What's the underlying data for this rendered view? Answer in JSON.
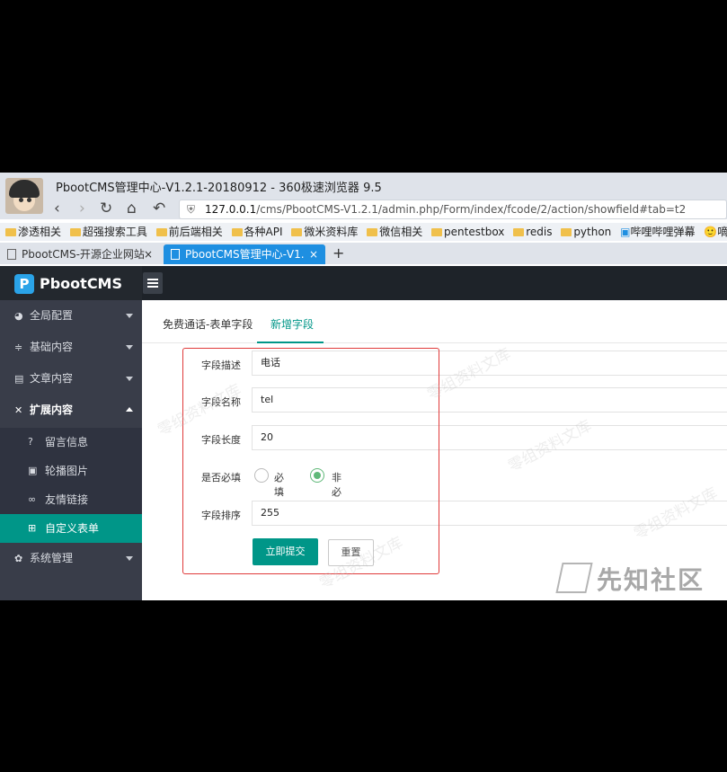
{
  "browser": {
    "window_title": "PbootCMS管理中心-V1.2.1-20180912 - 360极速浏览器 9.5",
    "url_host": "127.0.0.1",
    "url_path": "/cms/PbootCMS-V1.2.1/admin.php/Form/index/fcode/2/action/showfield#tab=t2",
    "bookmarks": [
      "渗透相关",
      "超强搜索工具",
      "前后端相关",
      "各种API",
      "微米资料库",
      "微信相关",
      "pentestbox",
      "redis",
      "python",
      "哔哩哔哩弹幕",
      "嘀哩嘀"
    ],
    "tabs": [
      {
        "label": "PbootCMS-开源企业网站",
        "active": false
      },
      {
        "label": "PbootCMS管理中心-V1.",
        "active": true
      }
    ],
    "new_tab_symbol": "+",
    "close_symbol": "×"
  },
  "app": {
    "logo_text": "PbootCMS",
    "logo_letter": "P",
    "sidebar": {
      "menus": [
        {
          "icon": "globe-icon",
          "glyph": "◕",
          "label": "全局配置"
        },
        {
          "icon": "sliders-icon",
          "glyph": "≑",
          "label": "基础内容"
        },
        {
          "icon": "document-icon",
          "glyph": "▤",
          "label": "文章内容"
        },
        {
          "icon": "expand-icon",
          "glyph": "✕",
          "label": "扩展内容"
        },
        {
          "icon": "gear-icon",
          "glyph": "✿",
          "label": "系统管理"
        }
      ],
      "submenus": [
        {
          "icon": "question-icon",
          "glyph": "?",
          "label": "留言信息"
        },
        {
          "icon": "image-icon",
          "glyph": "▣",
          "label": "轮播图片"
        },
        {
          "icon": "link-icon",
          "glyph": "∞",
          "label": "友情链接"
        },
        {
          "icon": "form-icon",
          "glyph": "⊞",
          "label": "自定义表单"
        }
      ]
    },
    "content_tabs": [
      "免费通话-表单字段",
      "新增字段"
    ],
    "form": {
      "field_desc_label": "字段描述",
      "field_desc_value": "电话",
      "field_name_label": "字段名称",
      "field_name_value": "tel",
      "field_length_label": "字段长度",
      "field_length_value": "20",
      "required_label": "是否必填",
      "required_option": "必填",
      "not_required_option": "非必填",
      "order_label": "字段排序",
      "order_value": "255",
      "submit_label": "立即提交",
      "reset_label": "重置"
    }
  },
  "watermark_text": "零组资料文库",
  "xianzhi_logo_text": "先知社区",
  "colors": {
    "accent": "#009688",
    "sidebar": "#393d49",
    "browser_tab": "#1e8fe1",
    "highlight": "#e03a3a"
  }
}
